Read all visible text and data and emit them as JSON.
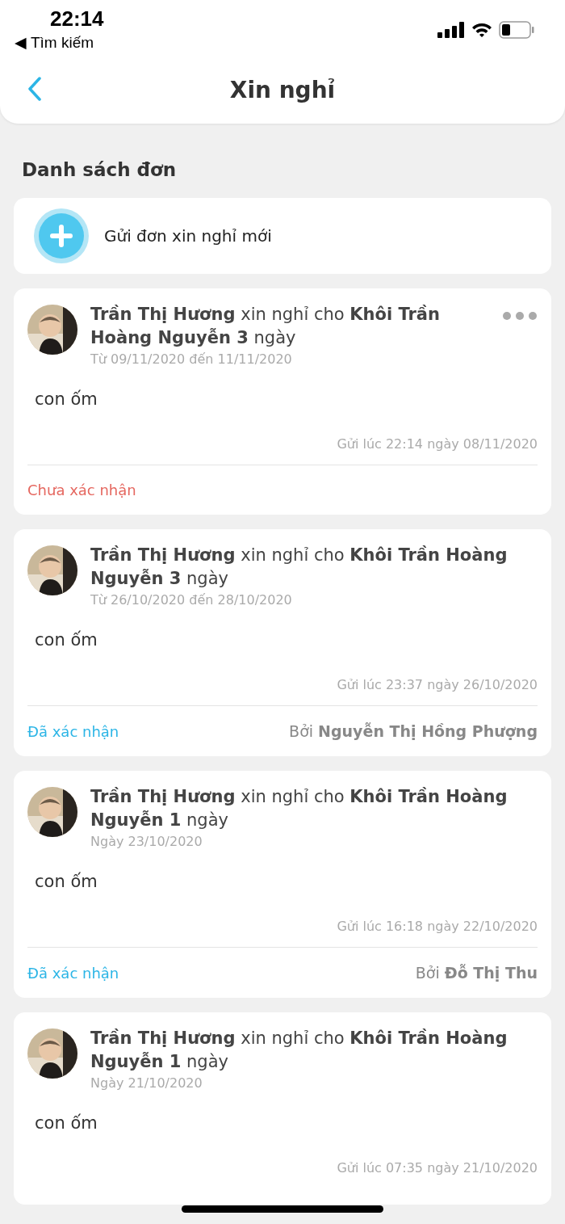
{
  "status_bar": {
    "time": "22:14",
    "back_app": "◀ Tìm kiếm"
  },
  "nav": {
    "title": "Xin nghỉ"
  },
  "section_title": "Danh sách đơn",
  "new_request": {
    "label": "Gửi đơn xin nghỉ mới"
  },
  "requests": [
    {
      "title": "**Trần Thị Hương** xin nghỉ cho **Khôi Trần Hoàng Nguyễn 3** ngày",
      "dates": "Từ 09/11/2020 đến 11/11/2020",
      "reason": "con ốm",
      "sent": "Gửi lúc 22:14 ngày 08/11/2020",
      "has_menu": true,
      "status": {
        "kind": "pending",
        "label": "Chưa xác nhận"
      }
    },
    {
      "title": "**Trần Thị Hương** xin nghỉ cho **Khôi Trần Hoàng Nguyễn 3** ngày",
      "dates": "Từ 26/10/2020 đến 28/10/2020",
      "reason": "con ốm",
      "sent": "Gửi lúc 23:37 ngày 26/10/2020",
      "has_menu": false,
      "status": {
        "kind": "confirmed",
        "label": "Đã xác nhận",
        "by": "Bởi **Nguyễn Thị Hồng Phượng**"
      }
    },
    {
      "title": "**Trần Thị Hương** xin nghỉ cho **Khôi Trần Hoàng Nguyễn 1** ngày",
      "dates": "Ngày 23/10/2020",
      "reason": "con ốm",
      "sent": "Gửi lúc 16:18 ngày 22/10/2020",
      "has_menu": false,
      "status": {
        "kind": "confirmed",
        "label": "Đã xác nhận",
        "by": "Bởi **Đỗ Thị Thu**"
      }
    },
    {
      "title": "**Trần Thị Hương** xin nghỉ cho **Khôi Trần Hoàng Nguyễn 1** ngày",
      "dates": "Ngày 21/10/2020",
      "reason": "con ốm",
      "sent": "Gửi lúc 07:35 ngày 21/10/2020",
      "has_menu": false
    }
  ]
}
